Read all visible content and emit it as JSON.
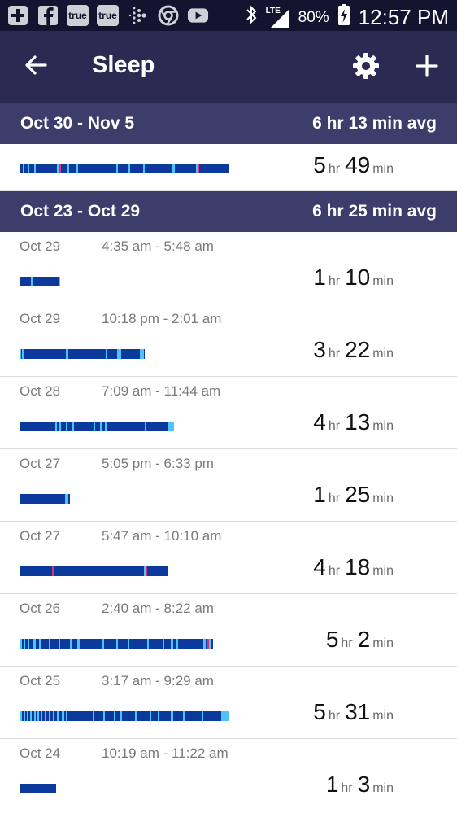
{
  "status_bar": {
    "icons": [
      "plus-box-icon",
      "facebook-icon",
      "true-icon",
      "true-icon",
      "fitbit-icon",
      "chrome-icon",
      "youtube-icon",
      "bluetooth-icon",
      "signal-lte-icon",
      "battery-charging-icon"
    ],
    "true_label": "true",
    "lte_label": "LTE",
    "battery": "80%",
    "time": "12:57 PM"
  },
  "app_bar": {
    "title": "Sleep",
    "icons": [
      "back-arrow-icon",
      "gear-icon",
      "plus-icon"
    ]
  },
  "colors": {
    "status_bar": "#141430",
    "app_bar": "#2a2a52",
    "week_header": "#3d3d6b",
    "asleep": "#0b3a9c",
    "restless": "#4fc3f7",
    "awake": "#d6337a"
  },
  "units": {
    "hr": "hr",
    "min": "min"
  },
  "weeks": [
    {
      "range": "Oct 30 - Nov 5",
      "avg": "6 hr 13 min avg",
      "entries": [
        {
          "date": "",
          "time": "",
          "hours": "5",
          "minutes": "49",
          "bar_fraction": 0.92,
          "marks": [
            {
              "pos": 0.015,
              "w": 0.008,
              "type": "restless"
            },
            {
              "pos": 0.04,
              "w": 0.006,
              "type": "restless"
            },
            {
              "pos": 0.07,
              "w": 0.006,
              "type": "restless"
            },
            {
              "pos": 0.18,
              "w": 0.01,
              "type": "restless"
            },
            {
              "pos": 0.19,
              "w": 0.006,
              "type": "awake"
            },
            {
              "pos": 0.23,
              "w": 0.006,
              "type": "restless"
            },
            {
              "pos": 0.27,
              "w": 0.006,
              "type": "restless"
            },
            {
              "pos": 0.46,
              "w": 0.006,
              "type": "restless"
            },
            {
              "pos": 0.52,
              "w": 0.006,
              "type": "restless"
            },
            {
              "pos": 0.59,
              "w": 0.006,
              "type": "restless"
            },
            {
              "pos": 0.73,
              "w": 0.012,
              "type": "restless"
            },
            {
              "pos": 0.84,
              "w": 0.012,
              "type": "restless"
            },
            {
              "pos": 0.85,
              "w": 0.008,
              "type": "awake"
            }
          ]
        }
      ]
    },
    {
      "range": "Oct 23 - Oct 29",
      "avg": "6 hr 25 min avg",
      "entries": [
        {
          "date": "Oct 29",
          "time": "4:35 am - 5:48 am",
          "hours": "1",
          "minutes": "10",
          "bar_fraction": 0.18,
          "marks": [
            {
              "pos": 0.28,
              "w": 0.03,
              "type": "restless"
            },
            {
              "pos": 0.96,
              "w": 0.04,
              "type": "restless"
            }
          ]
        },
        {
          "date": "Oct 29",
          "time": "10:18 pm - 2:01 am",
          "hours": "3",
          "minutes": "22",
          "bar_fraction": 0.55,
          "marks": [
            {
              "pos": 0.0,
              "w": 0.015,
              "type": "restless"
            },
            {
              "pos": 0.02,
              "w": 0.012,
              "type": "restless"
            },
            {
              "pos": 0.37,
              "w": 0.02,
              "type": "restless"
            },
            {
              "pos": 0.69,
              "w": 0.012,
              "type": "restless"
            },
            {
              "pos": 0.78,
              "w": 0.03,
              "type": "restless"
            },
            {
              "pos": 0.96,
              "w": 0.03,
              "type": "restless"
            }
          ]
        },
        {
          "date": "Oct 28",
          "time": "7:09 am - 11:44 am",
          "hours": "4",
          "minutes": "13",
          "bar_fraction": 0.68,
          "marks": [
            {
              "pos": 0.23,
              "w": 0.008,
              "type": "restless"
            },
            {
              "pos": 0.26,
              "w": 0.008,
              "type": "restless"
            },
            {
              "pos": 0.3,
              "w": 0.008,
              "type": "restless"
            },
            {
              "pos": 0.34,
              "w": 0.012,
              "type": "restless"
            },
            {
              "pos": 0.48,
              "w": 0.008,
              "type": "restless"
            },
            {
              "pos": 0.52,
              "w": 0.008,
              "type": "restless"
            },
            {
              "pos": 0.55,
              "w": 0.012,
              "type": "restless"
            },
            {
              "pos": 0.81,
              "w": 0.01,
              "type": "restless"
            },
            {
              "pos": 0.96,
              "w": 0.04,
              "type": "restless"
            }
          ]
        },
        {
          "date": "Oct 27",
          "time": "5:05 pm - 6:33 pm",
          "hours": "1",
          "minutes": "25",
          "bar_fraction": 0.22,
          "marks": [
            {
              "pos": 0.9,
              "w": 0.06,
              "type": "restless"
            }
          ]
        },
        {
          "date": "Oct 27",
          "time": "5:47 am - 10:10 am",
          "hours": "4",
          "minutes": "18",
          "bar_fraction": 0.65,
          "marks": [
            {
              "pos": 0.22,
              "w": 0.012,
              "type": "awake"
            },
            {
              "pos": 0.84,
              "w": 0.008,
              "type": "restless"
            },
            {
              "pos": 0.85,
              "w": 0.008,
              "type": "awake"
            }
          ]
        },
        {
          "date": "Oct 26",
          "time": "2:40 am - 8:22 am",
          "hours": "5",
          "minutes": "2",
          "bar_fraction": 0.85,
          "marks": [
            {
              "pos": 0.0,
              "w": 0.012,
              "type": "restless"
            },
            {
              "pos": 0.02,
              "w": 0.008,
              "type": "restless"
            },
            {
              "pos": 0.04,
              "w": 0.008,
              "type": "restless"
            },
            {
              "pos": 0.07,
              "w": 0.012,
              "type": "restless"
            },
            {
              "pos": 0.1,
              "w": 0.008,
              "type": "restless"
            },
            {
              "pos": 0.15,
              "w": 0.008,
              "type": "restless"
            },
            {
              "pos": 0.2,
              "w": 0.008,
              "type": "restless"
            },
            {
              "pos": 0.26,
              "w": 0.008,
              "type": "restless"
            },
            {
              "pos": 0.3,
              "w": 0.012,
              "type": "restless"
            },
            {
              "pos": 0.43,
              "w": 0.008,
              "type": "restless"
            },
            {
              "pos": 0.5,
              "w": 0.008,
              "type": "restless"
            },
            {
              "pos": 0.56,
              "w": 0.008,
              "type": "restless"
            },
            {
              "pos": 0.66,
              "w": 0.008,
              "type": "restless"
            },
            {
              "pos": 0.74,
              "w": 0.008,
              "type": "restless"
            },
            {
              "pos": 0.78,
              "w": 0.012,
              "type": "restless"
            },
            {
              "pos": 0.81,
              "w": 0.008,
              "type": "restless"
            },
            {
              "pos": 0.95,
              "w": 0.012,
              "type": "restless"
            },
            {
              "pos": 0.965,
              "w": 0.012,
              "type": "awake"
            },
            {
              "pos": 0.98,
              "w": 0.012,
              "type": "restless"
            }
          ]
        },
        {
          "date": "Oct 25",
          "time": "3:17 am - 9:29 am",
          "hours": "5",
          "minutes": "31",
          "bar_fraction": 0.92,
          "marks": [
            {
              "pos": 0.0,
              "w": 0.01,
              "type": "restless"
            },
            {
              "pos": 0.02,
              "w": 0.006,
              "type": "restless"
            },
            {
              "pos": 0.035,
              "w": 0.006,
              "type": "restless"
            },
            {
              "pos": 0.05,
              "w": 0.006,
              "type": "restless"
            },
            {
              "pos": 0.07,
              "w": 0.006,
              "type": "restless"
            },
            {
              "pos": 0.085,
              "w": 0.006,
              "type": "restless"
            },
            {
              "pos": 0.1,
              "w": 0.006,
              "type": "restless"
            },
            {
              "pos": 0.12,
              "w": 0.006,
              "type": "restless"
            },
            {
              "pos": 0.14,
              "w": 0.006,
              "type": "restless"
            },
            {
              "pos": 0.16,
              "w": 0.006,
              "type": "restless"
            },
            {
              "pos": 0.18,
              "w": 0.006,
              "type": "restless"
            },
            {
              "pos": 0.2,
              "w": 0.012,
              "type": "restless"
            },
            {
              "pos": 0.22,
              "w": 0.006,
              "type": "restless"
            },
            {
              "pos": 0.35,
              "w": 0.006,
              "type": "restless"
            },
            {
              "pos": 0.4,
              "w": 0.006,
              "type": "restless"
            },
            {
              "pos": 0.45,
              "w": 0.006,
              "type": "restless"
            },
            {
              "pos": 0.48,
              "w": 0.006,
              "type": "restless"
            },
            {
              "pos": 0.55,
              "w": 0.006,
              "type": "restless"
            },
            {
              "pos": 0.62,
              "w": 0.006,
              "type": "restless"
            },
            {
              "pos": 0.66,
              "w": 0.006,
              "type": "restless"
            },
            {
              "pos": 0.72,
              "w": 0.012,
              "type": "restless"
            },
            {
              "pos": 0.78,
              "w": 0.006,
              "type": "restless"
            },
            {
              "pos": 0.87,
              "w": 0.006,
              "type": "restless"
            },
            {
              "pos": 0.96,
              "w": 0.04,
              "type": "restless"
            }
          ]
        },
        {
          "date": "Oct 24",
          "time": "10:19 am - 11:22 am",
          "hours": "1",
          "minutes": "3",
          "bar_fraction": 0.16,
          "marks": []
        }
      ]
    }
  ]
}
